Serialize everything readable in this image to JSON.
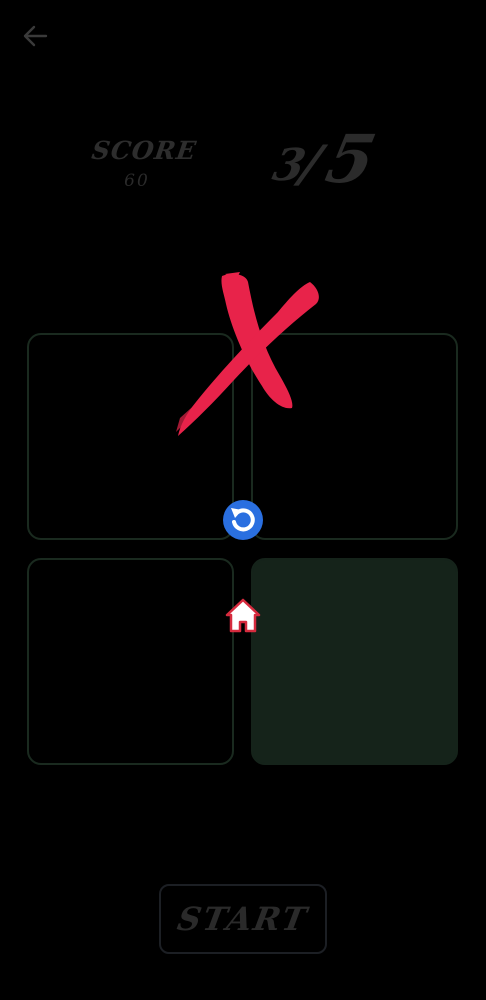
{
  "header": {
    "back_icon": "arrow-left-icon"
  },
  "score": {
    "label": "SCORE",
    "value": "60"
  },
  "round": {
    "current": "3",
    "separator": "/",
    "total": "5"
  },
  "board": {
    "highlighted_tile": "bottom-right"
  },
  "result": {
    "mark": "wrong-x-icon",
    "mark_color": "#e8234a"
  },
  "controls": {
    "replay_icon": "replay-icon",
    "home_icon": "home-icon",
    "start_label": "START"
  },
  "colors": {
    "tile_border": "#1a2a1f",
    "tile_highlight": "#15231a",
    "accent_blue": "#2a6fe0"
  }
}
